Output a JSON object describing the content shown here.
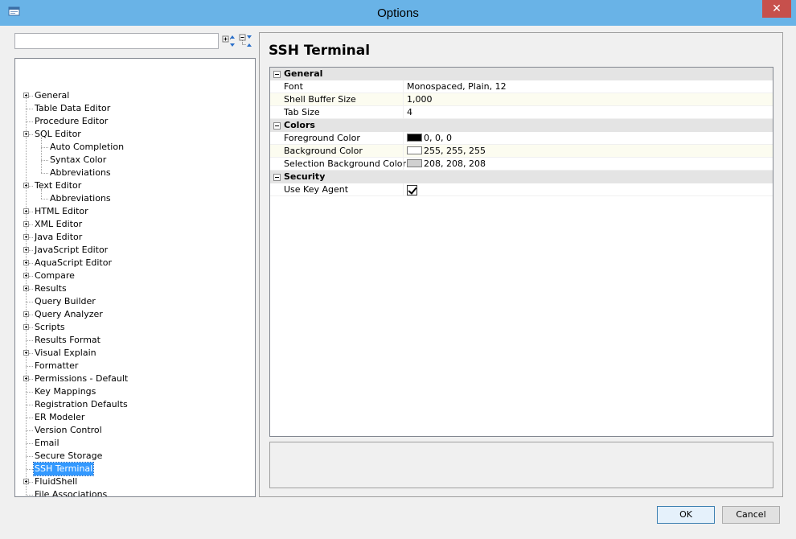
{
  "window": {
    "title": "Options",
    "close_glyph": "✕"
  },
  "toolbar": {
    "expand_icon": "expand-all-icon",
    "collapse_icon": "collapse-all-icon",
    "search_value": ""
  },
  "tree": {
    "items": [
      {
        "label": "General",
        "level": 0,
        "expandable": true
      },
      {
        "label": "Table Data Editor",
        "level": 0,
        "expandable": false
      },
      {
        "label": "Procedure Editor",
        "level": 0,
        "expandable": false
      },
      {
        "label": "SQL Editor",
        "level": 0,
        "expandable": true
      },
      {
        "label": "Auto Completion",
        "level": 1,
        "expandable": false
      },
      {
        "label": "Syntax Color",
        "level": 1,
        "expandable": false
      },
      {
        "label": "Abbreviations",
        "level": 1,
        "expandable": false
      },
      {
        "label": "Text Editor",
        "level": 0,
        "expandable": true
      },
      {
        "label": "Abbreviations",
        "level": 1,
        "expandable": false
      },
      {
        "label": "HTML Editor",
        "level": 0,
        "expandable": true
      },
      {
        "label": "XML Editor",
        "level": 0,
        "expandable": true
      },
      {
        "label": "Java Editor",
        "level": 0,
        "expandable": true
      },
      {
        "label": "JavaScript Editor",
        "level": 0,
        "expandable": true
      },
      {
        "label": "AquaScript Editor",
        "level": 0,
        "expandable": true
      },
      {
        "label": "Compare",
        "level": 0,
        "expandable": true
      },
      {
        "label": "Results",
        "level": 0,
        "expandable": true
      },
      {
        "label": "Query Builder",
        "level": 0,
        "expandable": false
      },
      {
        "label": "Query Analyzer",
        "level": 0,
        "expandable": true
      },
      {
        "label": "Scripts",
        "level": 0,
        "expandable": true
      },
      {
        "label": "Results Format",
        "level": 0,
        "expandable": false
      },
      {
        "label": "Visual Explain",
        "level": 0,
        "expandable": true
      },
      {
        "label": "Formatter",
        "level": 0,
        "expandable": false
      },
      {
        "label": "Permissions - Default",
        "level": 0,
        "expandable": true
      },
      {
        "label": "Key Mappings",
        "level": 0,
        "expandable": false
      },
      {
        "label": "Registration Defaults",
        "level": 0,
        "expandable": false
      },
      {
        "label": "ER Modeler",
        "level": 0,
        "expandable": false
      },
      {
        "label": "Version Control",
        "level": 0,
        "expandable": false
      },
      {
        "label": "Email",
        "level": 0,
        "expandable": false
      },
      {
        "label": "Secure Storage",
        "level": 0,
        "expandable": false
      },
      {
        "label": "SSH Terminal",
        "level": 0,
        "expandable": false,
        "selected": true
      },
      {
        "label": "FluidShell",
        "level": 0,
        "expandable": true
      },
      {
        "label": "File Associations",
        "level": 0,
        "expandable": false
      }
    ]
  },
  "panel": {
    "title": "SSH Terminal",
    "categories": [
      {
        "label": "General",
        "props": [
          {
            "name": "Font",
            "value": "Monospaced, Plain, 12"
          },
          {
            "name": "Shell Buffer Size",
            "value": "1,000"
          },
          {
            "name": "Tab Size",
            "value": "4"
          }
        ]
      },
      {
        "label": "Colors",
        "props": [
          {
            "name": "Foreground Color",
            "value": "0, 0, 0",
            "swatch": "#000000"
          },
          {
            "name": "Background Color",
            "value": "255, 255, 255",
            "swatch": "#ffffff"
          },
          {
            "name": "Selection Background Color",
            "value": "208, 208, 208",
            "swatch": "#d0d0d0"
          }
        ]
      },
      {
        "label": "Security",
        "props": [
          {
            "name": "Use Key Agent",
            "checkbox": true,
            "checked": true
          }
        ]
      }
    ]
  },
  "buttons": {
    "ok": "OK",
    "cancel": "Cancel"
  },
  "colors": {
    "titlebar": "#69b3e7",
    "close": "#c7504c",
    "selection": "#3399ff"
  }
}
